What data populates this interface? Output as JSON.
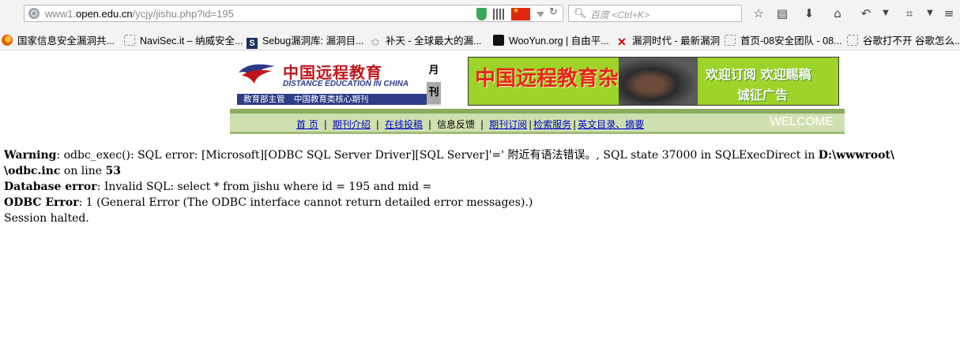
{
  "browser": {
    "url_prefix": "www1.",
    "url_domain": "open.edu.cn",
    "url_path": "/ycjy/jishu.php?id=195",
    "search_placeholder": "百度 <Ctrl+K>",
    "bookmarks": [
      {
        "label": "国家信息安全漏洞共...",
        "icon": "firefox-icon"
      },
      {
        "label": "NaviSec.it – 纳威安全...",
        "icon": "blank-page-icon"
      },
      {
        "label": "Sebug漏洞库: 漏洞目...",
        "icon": "sebug-icon"
      },
      {
        "label": "补天 - 全球最大的漏...",
        "icon": "star-icon"
      },
      {
        "label": "WooYun.org | 自由平...",
        "icon": "wooyun-icon"
      },
      {
        "label": "漏洞时代 - 最新漏洞",
        "icon": "x-icon"
      },
      {
        "label": "首页-08安全团队 - 08...",
        "icon": "blank-page-icon"
      },
      {
        "label": "谷歌打不开 谷歌怎么...",
        "icon": "blank-page-icon"
      }
    ]
  },
  "logo": {
    "cn": "中国远程教育",
    "en": "DISTANCE EDUCATION IN CHINA",
    "sub1": "教育部主管",
    "sub2": "中国教育类核心期刊",
    "month1": "月",
    "month2": "刊"
  },
  "banner": {
    "title": "中国远程教育杂志",
    "slogan1": "欢迎订阅 欢迎赐稿",
    "slogan2": "诚征广告"
  },
  "nav": {
    "items": [
      "首 页",
      "期刊介绍",
      "在线投稿",
      "信息反馈",
      "期刊订阅",
      "检索服务",
      "英文目录、摘要"
    ],
    "welcome": "WELCOME"
  },
  "error": {
    "warning_label": "Warning",
    "warning_text": ": odbc_exec(): SQL error: [Microsoft][ODBC SQL Server Driver][SQL Server]'=' 附近有语法错误。, SQL state 37000 in SQLExecDirect in ",
    "warning_path": "D:\\wwwroot\\",
    "warning_file": "\\odbc.inc",
    "on_line": " on line ",
    "line_no": "53",
    "db_label": "Database error",
    "db_text": ": Invalid SQL: select * from jishu where id = 195 and mid =",
    "odbc_label": "ODBC Error",
    "odbc_text": ": 1 (General Error (The ODBC interface cannot return detailed error messages).)",
    "halted": "Session halted."
  }
}
